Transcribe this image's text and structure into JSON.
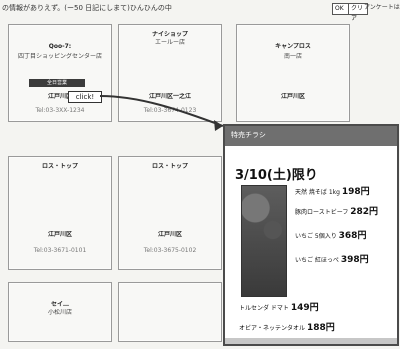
{
  "top_note": "の情報がありえず。(ー50 日記にしまて)ひんひんの中",
  "top_buttons": [
    "OK",
    "クリア"
  ],
  "top_right_text": "アンケートはこちら",
  "stores": [
    {
      "name": "Qoo-7:",
      "branch": "四丁目ショッピングセンター店",
      "status": "全日営業",
      "address_label": "江戸川区",
      "address": "",
      "phone": "Tel:03-3XX-1234"
    },
    {
      "name": "ナイショップ",
      "branch": "エールー店",
      "status": "",
      "address_label": "江戸川区一之江",
      "address": "",
      "phone": "Tel:03-3674-0123"
    },
    {
      "name": "キャンプロス",
      "branch": "南一店",
      "status": "",
      "address_label": "江戸川区",
      "address": "",
      "phone": ""
    },
    {
      "name": "ロス・トップ",
      "branch": "",
      "status": "",
      "address_label": "江戸川区",
      "address": "",
      "phone": "Tel:03-3671-0101"
    },
    {
      "name": "ロス・トップ",
      "branch": "",
      "status": "",
      "address_label": "江戸川区",
      "address": "",
      "phone": "Tel:03-3675-0102"
    },
    {
      "name": "セイ…",
      "branch": "小松川店",
      "status": "",
      "address_label": "",
      "address": "",
      "phone": ""
    },
    {
      "name": "",
      "branch": "",
      "status": "",
      "address_label": "",
      "address": "",
      "phone": ""
    }
  ],
  "click_label": "click!",
  "popup": {
    "title": "特売チラシ",
    "headline": "3/10(土)限り",
    "items": [
      {
        "name": "天然 焼そば 1kg",
        "price": "198円"
      },
      {
        "name": "豚肉ローストビーフ",
        "price": "282円"
      },
      {
        "name": "いちご 5個入り",
        "price": "368円"
      },
      {
        "name": "いちご 紅ほっぺ",
        "price": "398円"
      },
      {
        "name": "トルセンダ ドマト",
        "price": "149円"
      },
      {
        "name": "オビア・ネッテンタオル",
        "price": "188円"
      }
    ]
  }
}
